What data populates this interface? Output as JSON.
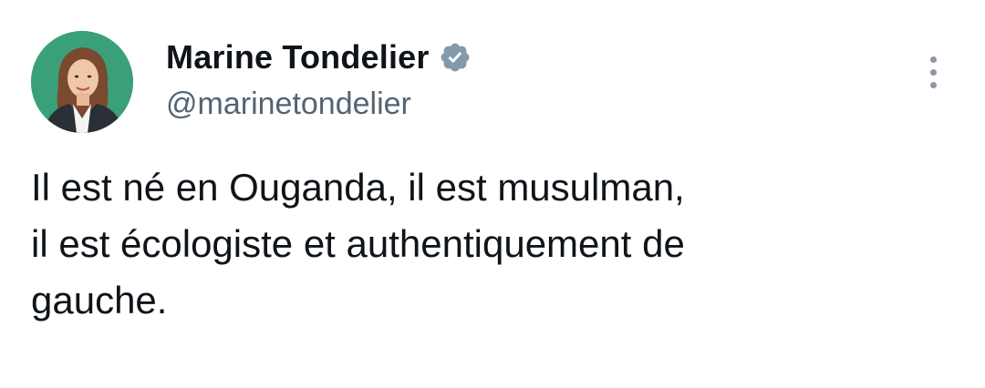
{
  "author": {
    "display_name": "Marine Tondelier",
    "handle": "@marinetondelier",
    "verified": true,
    "verified_badge_color": "#829aab",
    "avatar_background": "#3aa07a"
  },
  "tweet": {
    "lines": [
      "Il est né en Ouganda, il est musulman,",
      "il est écologiste et authentiquement de",
      "gauche."
    ]
  },
  "icons": {
    "more": "more-options-icon",
    "verified": "verified-badge-icon"
  }
}
